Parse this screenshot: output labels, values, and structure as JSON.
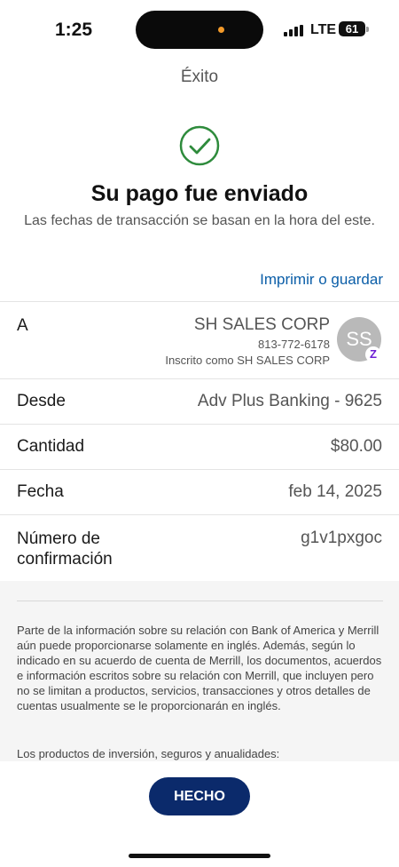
{
  "status_bar": {
    "time": "1:25",
    "network": "LTE",
    "battery": "61"
  },
  "page": {
    "title": "Éxito"
  },
  "confirmation": {
    "icon": "check-circle-icon",
    "icon_color": "#2e8b3c",
    "headline": "Su pago fue enviado",
    "subtext": "Las fechas de transacción se basan en la hora del este.",
    "print_link": "Imprimir o guardar"
  },
  "details": {
    "to": {
      "label": "A",
      "name": "SH SALES CORP",
      "phone": "813-772-6178",
      "enrolled": "Inscrito como SH SALES CORP",
      "avatar_initials": "SS",
      "badge_icon": "zelle-icon",
      "badge_color": "#6d1ed4"
    },
    "from": {
      "label": "Desde",
      "value": "Adv Plus Banking - 9625"
    },
    "amount": {
      "label": "Cantidad",
      "value": "$80.00"
    },
    "date": {
      "label": "Fecha",
      "value": "feb 14, 2025"
    },
    "confirmation_number": {
      "label": "Número de confirmación",
      "value": "g1v1pxgoc"
    }
  },
  "disclaimer": {
    "paragraph1": "Parte de la información sobre su relación con Bank of America y Merrill aún puede proporcionarse solamente en inglés. Además, según lo indicado en su acuerdo de cuenta de Merrill, los documentos, acuerdos e información escritos sobre su relación con Merrill, que incluyen pero no se limitan a productos, servicios, transacciones y otros detalles de cuentas usualmente se le proporcionarán en inglés.",
    "paragraph2": "Los productos de inversión, seguros y anualidades:"
  },
  "actions": {
    "done_label": "HECHO",
    "done_color": "#0b2a6b"
  },
  "colors": {
    "link": "#0b5ea8"
  }
}
